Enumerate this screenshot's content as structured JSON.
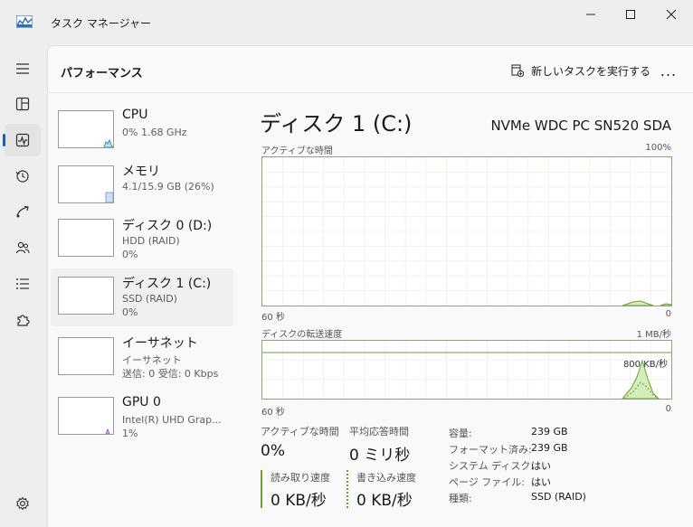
{
  "window": {
    "title": "タスク マネージャー"
  },
  "header": {
    "title": "パフォーマンス",
    "run_new_task": "新しいタスクを実行する",
    "more": "..."
  },
  "devices": [
    {
      "name": "CPU",
      "sub1": "0%  1.68 GHz",
      "sub2": ""
    },
    {
      "name": "メモリ",
      "sub1": "4.1/15.9 GB (26%)",
      "sub2": ""
    },
    {
      "name": "ディスク 0 (D:)",
      "sub1": "HDD (RAID)",
      "sub2": "0%"
    },
    {
      "name": "ディスク 1 (C:)",
      "sub1": "SSD (RAID)",
      "sub2": "0%"
    },
    {
      "name": "イーサネット",
      "sub1": "イーサネット",
      "sub2": "送信: 0 受信: 0 Kbps"
    },
    {
      "name": "GPU 0",
      "sub1": "Intel(R) UHD Grap...",
      "sub2": "1%"
    }
  ],
  "detail": {
    "title": "ディスク 1 (C:)",
    "model": "NVMe WDC PC SN520 SDA",
    "active_label": "アクティブな時間",
    "active_max": "100%",
    "active_x_left": "60 秒",
    "active_x_right": "0",
    "transfer_label": "ディスクの転送速度",
    "transfer_max": "1 MB/秒",
    "transfer_mid": "800 KB/秒",
    "transfer_x_left": "60 秒",
    "transfer_x_right": "0"
  },
  "stats": {
    "active_time_label": "アクティブな時間",
    "active_time_value": "0%",
    "avg_response_label": "平均応答時間",
    "avg_response_value": "0 ミリ秒",
    "read_label": "読み取り速度",
    "read_value": "0 KB/秒",
    "write_label": "書き込み速度",
    "write_value": "0 KB/秒"
  },
  "info": [
    {
      "key": "容量:",
      "value": "239 GB"
    },
    {
      "key": "フォーマット済み:",
      "value": "239 GB"
    },
    {
      "key": "システム ディスク:",
      "value": "はい"
    },
    {
      "key": "ページ ファイル:",
      "value": "はい"
    },
    {
      "key": "種類:",
      "value": "SSD (RAID)"
    }
  ],
  "colors": {
    "accent": "#1a5fb4",
    "disk_line": "#6ba033",
    "disk_fill": "#d5ecbb",
    "cpu": "#2d8fb5",
    "memory": "#7aa3d6",
    "gpu": "#8e5bb5"
  }
}
